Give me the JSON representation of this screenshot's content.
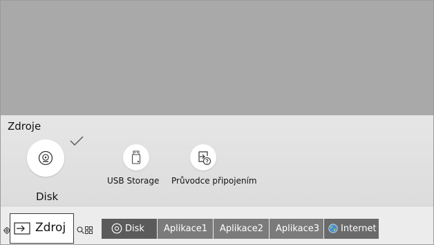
{
  "panel": {
    "title": "Zdroje"
  },
  "sources": {
    "disk": {
      "label": "Disk",
      "icon": "disc-icon",
      "selected": true
    },
    "usb": {
      "label": "USB Storage",
      "icon": "usb-drive-icon"
    },
    "guide": {
      "label": "Průvodce připojením",
      "icon": "connection-guide-icon"
    }
  },
  "bottom_bar": {
    "source_button": {
      "label": "Zdroj",
      "icon": "input-source-icon"
    },
    "settings_icon": "gear-icon",
    "search_icon": "search-icon",
    "apps_icon": "apps-grid-icon",
    "tabs": [
      {
        "label": "Disk",
        "icon": "disc-icon"
      },
      {
        "label": "Aplikace1"
      },
      {
        "label": "Aplikace2"
      },
      {
        "label": "Aplikace3"
      },
      {
        "label": "Internet",
        "icon": "globe-icon"
      }
    ]
  },
  "colors": {
    "preview_bg": "#a9a9a9",
    "panel_bg": "#dedede",
    "tab_bg": "#7b7b7b",
    "tab_active_bg": "#5b5b5b"
  }
}
